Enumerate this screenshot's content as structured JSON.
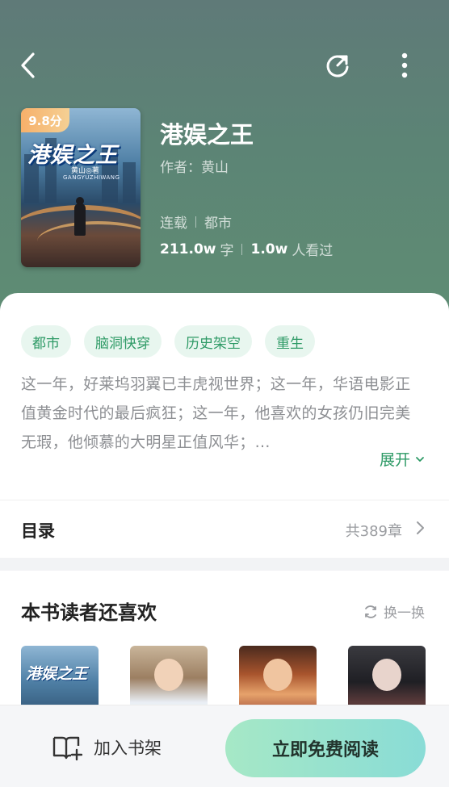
{
  "header": {
    "back_icon": "chevron-left-icon",
    "share_icon": "share-refresh-icon",
    "more_icon": "more-vertical-icon"
  },
  "book": {
    "score": "9.8分",
    "cover_title": "港娱之王",
    "cover_author": "黄山◎著",
    "cover_pinyin": "GANGYUZHIWANG",
    "title": "港娱之王",
    "author": "作者：黄山",
    "status": "连载",
    "category": "都市",
    "word_count": "211.0w",
    "word_unit": "字",
    "readers": "1.0w",
    "readers_unit": "人看过"
  },
  "tags": [
    "都市",
    "脑洞快穿",
    "历史架空",
    "重生"
  ],
  "description": "这一年，好莱坞羽翼已丰虎视世界；这一年，华语电影正值黄金时代的最后疯狂；这一年，他喜欢的女孩仍旧完美无瑕，他倾慕的大明星正值风华；…",
  "expand_label": "展开",
  "toc": {
    "label": "目录",
    "count": "共389章"
  },
  "recommend": {
    "title": "本书读者还喜欢",
    "refresh_label": "换一换",
    "books": [
      {
        "title": "港娱之王"
      },
      {
        "title": ""
      },
      {
        "title": ""
      },
      {
        "title": ""
      }
    ]
  },
  "bottom": {
    "shelf_label": "加入书架",
    "read_label": "立即免费阅读"
  },
  "colors": {
    "accent_green": "#2e9a66",
    "tag_bg": "#e8f6ef",
    "badge_orange": "#f7b06a"
  }
}
